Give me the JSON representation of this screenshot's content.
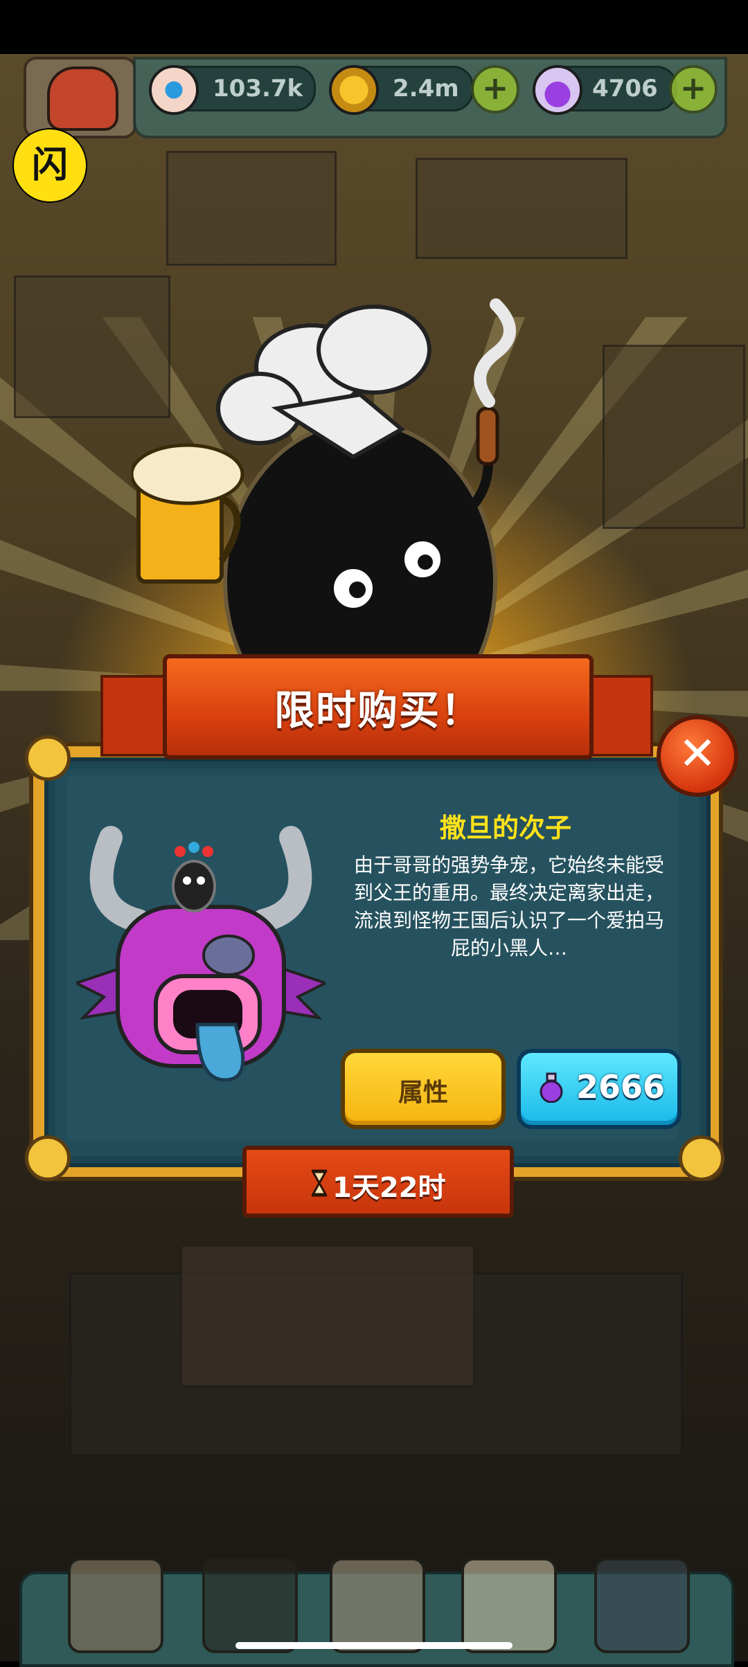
{
  "hud": {
    "eyeballs": "103.7k",
    "coins": "2.4m",
    "potions": "4706",
    "plus": "+"
  },
  "badge_glyph": "闪",
  "offer": {
    "title": "限时购买！",
    "close": "✕",
    "pet_name": "撒旦的次子",
    "description": "由于哥哥的强势争宠，它始终未能受到父王的重用。最终决定离家出走，流浪到怪物王国后认识了一个爱拍马屁的小黑人…",
    "attributes_button": "属性",
    "price": "2666",
    "timer": "1天22时"
  },
  "colors": {
    "ribbon": "#d9410f",
    "panel": "#214d5a",
    "attr_button": "#ffd83a",
    "buy_button": "#19b8e8",
    "name": "#ffe21a"
  },
  "icons": [
    "eyeball-icon",
    "coin-icon",
    "potion-icon",
    "hourglass-icon",
    "close-icon"
  ]
}
